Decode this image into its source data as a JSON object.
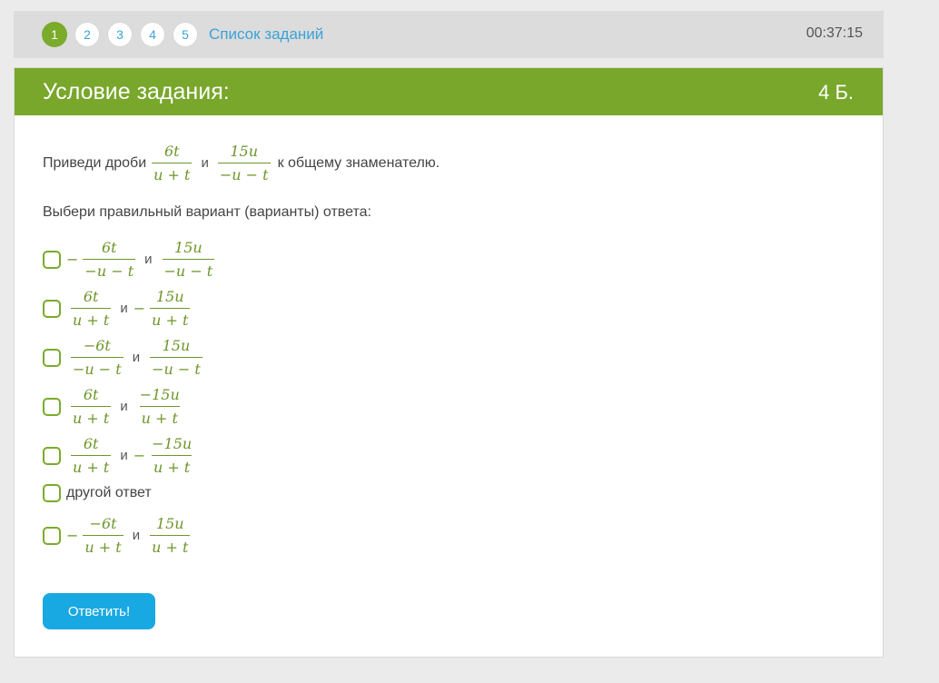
{
  "nav": {
    "pages": [
      "1",
      "2",
      "3",
      "4",
      "5"
    ],
    "task_list_label": "Список заданий",
    "timer": "00:37:15"
  },
  "task": {
    "title": "Условие задания:",
    "points": "4 Б.",
    "question_prefix": "Приведи дроби",
    "question_suffix": "к общему знаменателю.",
    "conjunction": "и",
    "fraction_a": {
      "num": "6t",
      "den": "u + t"
    },
    "fraction_b": {
      "num": "15u",
      "den": "−u − t"
    },
    "instruction": "Выбери правильный вариант (варианты) ответа:"
  },
  "options": [
    {
      "sign1": "−",
      "num1": "6t",
      "den1": "−u − t",
      "sign2": "",
      "num2": "15u",
      "den2": "−u − t"
    },
    {
      "sign1": "",
      "num1": "6t",
      "den1": "u + t",
      "sign2": "−",
      "num2": "15u",
      "den2": "u + t"
    },
    {
      "sign1": "",
      "num1": "−6t",
      "den1": "−u − t",
      "sign2": "",
      "num2": "15u",
      "den2": "−u − t"
    },
    {
      "sign1": "",
      "num1": "6t",
      "den1": "u + t",
      "sign2": "",
      "num2": "−15u",
      "den2": "u + t"
    },
    {
      "sign1": "",
      "num1": "6t",
      "den1": "u + t",
      "sign2": "−",
      "num2": "−15u",
      "den2": "u + t"
    },
    {
      "text": "другой ответ"
    },
    {
      "sign1": "−",
      "num1": "−6t",
      "den1": "u + t",
      "sign2": "",
      "num2": "15u",
      "den2": "u + t"
    }
  ],
  "submit_label": "Ответить!"
}
